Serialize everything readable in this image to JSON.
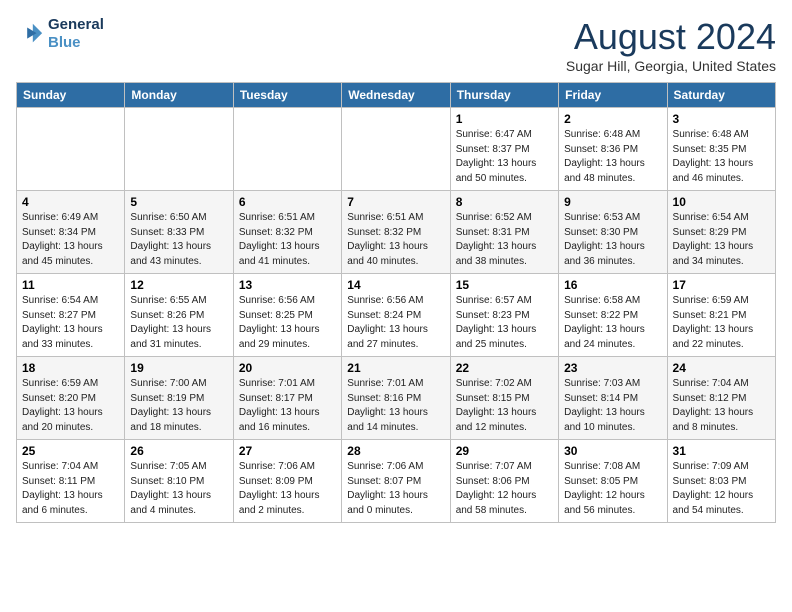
{
  "header": {
    "logo_line1": "General",
    "logo_line2": "Blue",
    "month": "August 2024",
    "location": "Sugar Hill, Georgia, United States"
  },
  "weekdays": [
    "Sunday",
    "Monday",
    "Tuesday",
    "Wednesday",
    "Thursday",
    "Friday",
    "Saturday"
  ],
  "weeks": [
    [
      {
        "day": "",
        "info": ""
      },
      {
        "day": "",
        "info": ""
      },
      {
        "day": "",
        "info": ""
      },
      {
        "day": "",
        "info": ""
      },
      {
        "day": "1",
        "info": "Sunrise: 6:47 AM\nSunset: 8:37 PM\nDaylight: 13 hours\nand 50 minutes."
      },
      {
        "day": "2",
        "info": "Sunrise: 6:48 AM\nSunset: 8:36 PM\nDaylight: 13 hours\nand 48 minutes."
      },
      {
        "day": "3",
        "info": "Sunrise: 6:48 AM\nSunset: 8:35 PM\nDaylight: 13 hours\nand 46 minutes."
      }
    ],
    [
      {
        "day": "4",
        "info": "Sunrise: 6:49 AM\nSunset: 8:34 PM\nDaylight: 13 hours\nand 45 minutes."
      },
      {
        "day": "5",
        "info": "Sunrise: 6:50 AM\nSunset: 8:33 PM\nDaylight: 13 hours\nand 43 minutes."
      },
      {
        "day": "6",
        "info": "Sunrise: 6:51 AM\nSunset: 8:32 PM\nDaylight: 13 hours\nand 41 minutes."
      },
      {
        "day": "7",
        "info": "Sunrise: 6:51 AM\nSunset: 8:32 PM\nDaylight: 13 hours\nand 40 minutes."
      },
      {
        "day": "8",
        "info": "Sunrise: 6:52 AM\nSunset: 8:31 PM\nDaylight: 13 hours\nand 38 minutes."
      },
      {
        "day": "9",
        "info": "Sunrise: 6:53 AM\nSunset: 8:30 PM\nDaylight: 13 hours\nand 36 minutes."
      },
      {
        "day": "10",
        "info": "Sunrise: 6:54 AM\nSunset: 8:29 PM\nDaylight: 13 hours\nand 34 minutes."
      }
    ],
    [
      {
        "day": "11",
        "info": "Sunrise: 6:54 AM\nSunset: 8:27 PM\nDaylight: 13 hours\nand 33 minutes."
      },
      {
        "day": "12",
        "info": "Sunrise: 6:55 AM\nSunset: 8:26 PM\nDaylight: 13 hours\nand 31 minutes."
      },
      {
        "day": "13",
        "info": "Sunrise: 6:56 AM\nSunset: 8:25 PM\nDaylight: 13 hours\nand 29 minutes."
      },
      {
        "day": "14",
        "info": "Sunrise: 6:56 AM\nSunset: 8:24 PM\nDaylight: 13 hours\nand 27 minutes."
      },
      {
        "day": "15",
        "info": "Sunrise: 6:57 AM\nSunset: 8:23 PM\nDaylight: 13 hours\nand 25 minutes."
      },
      {
        "day": "16",
        "info": "Sunrise: 6:58 AM\nSunset: 8:22 PM\nDaylight: 13 hours\nand 24 minutes."
      },
      {
        "day": "17",
        "info": "Sunrise: 6:59 AM\nSunset: 8:21 PM\nDaylight: 13 hours\nand 22 minutes."
      }
    ],
    [
      {
        "day": "18",
        "info": "Sunrise: 6:59 AM\nSunset: 8:20 PM\nDaylight: 13 hours\nand 20 minutes."
      },
      {
        "day": "19",
        "info": "Sunrise: 7:00 AM\nSunset: 8:19 PM\nDaylight: 13 hours\nand 18 minutes."
      },
      {
        "day": "20",
        "info": "Sunrise: 7:01 AM\nSunset: 8:17 PM\nDaylight: 13 hours\nand 16 minutes."
      },
      {
        "day": "21",
        "info": "Sunrise: 7:01 AM\nSunset: 8:16 PM\nDaylight: 13 hours\nand 14 minutes."
      },
      {
        "day": "22",
        "info": "Sunrise: 7:02 AM\nSunset: 8:15 PM\nDaylight: 13 hours\nand 12 minutes."
      },
      {
        "day": "23",
        "info": "Sunrise: 7:03 AM\nSunset: 8:14 PM\nDaylight: 13 hours\nand 10 minutes."
      },
      {
        "day": "24",
        "info": "Sunrise: 7:04 AM\nSunset: 8:12 PM\nDaylight: 13 hours\nand 8 minutes."
      }
    ],
    [
      {
        "day": "25",
        "info": "Sunrise: 7:04 AM\nSunset: 8:11 PM\nDaylight: 13 hours\nand 6 minutes."
      },
      {
        "day": "26",
        "info": "Sunrise: 7:05 AM\nSunset: 8:10 PM\nDaylight: 13 hours\nand 4 minutes."
      },
      {
        "day": "27",
        "info": "Sunrise: 7:06 AM\nSunset: 8:09 PM\nDaylight: 13 hours\nand 2 minutes."
      },
      {
        "day": "28",
        "info": "Sunrise: 7:06 AM\nSunset: 8:07 PM\nDaylight: 13 hours\nand 0 minutes."
      },
      {
        "day": "29",
        "info": "Sunrise: 7:07 AM\nSunset: 8:06 PM\nDaylight: 12 hours\nand 58 minutes."
      },
      {
        "day": "30",
        "info": "Sunrise: 7:08 AM\nSunset: 8:05 PM\nDaylight: 12 hours\nand 56 minutes."
      },
      {
        "day": "31",
        "info": "Sunrise: 7:09 AM\nSunset: 8:03 PM\nDaylight: 12 hours\nand 54 minutes."
      }
    ]
  ]
}
